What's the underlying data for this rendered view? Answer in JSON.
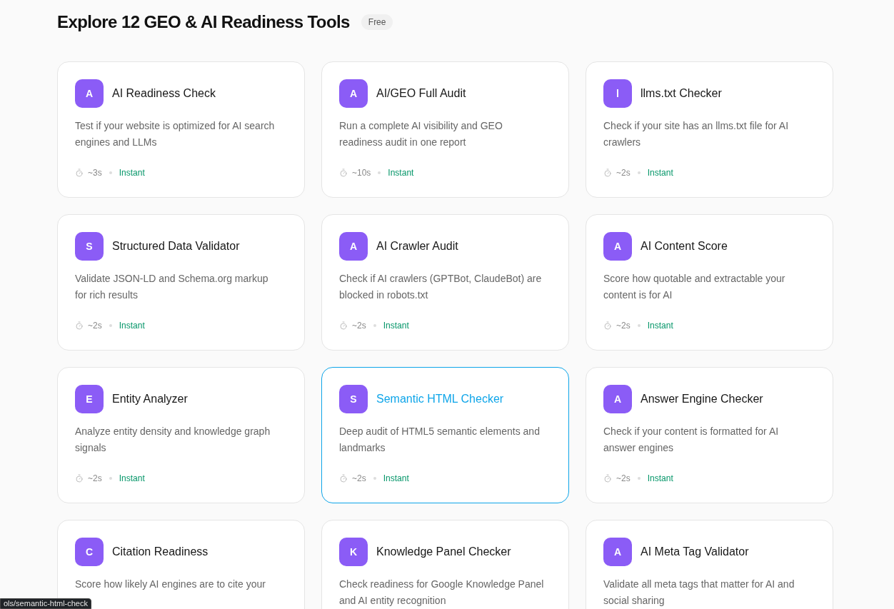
{
  "heading": {
    "title": "Explore 12 GEO & AI Readiness Tools",
    "badge": "Free"
  },
  "tools": [
    {
      "letter": "A",
      "name": "AI Readiness Check",
      "description": "Test if your website is optimized for AI search engines and LLMs",
      "time": "~3s",
      "speed": "Instant",
      "selected": false
    },
    {
      "letter": "A",
      "name": "AI/GEO Full Audit",
      "description": "Run a complete AI visibility and GEO readiness audit in one report",
      "time": "~10s",
      "speed": "Instant",
      "selected": false
    },
    {
      "letter": "l",
      "name": "llms.txt Checker",
      "description": "Check if your site has an llms.txt file for AI crawlers",
      "time": "~2s",
      "speed": "Instant",
      "selected": false
    },
    {
      "letter": "S",
      "name": "Structured Data Validator",
      "description": "Validate JSON-LD and Schema.org markup for rich results",
      "time": "~2s",
      "speed": "Instant",
      "selected": false
    },
    {
      "letter": "A",
      "name": "AI Crawler Audit",
      "description": "Check if AI crawlers (GPTBot, ClaudeBot) are blocked in robots.txt",
      "time": "~2s",
      "speed": "Instant",
      "selected": false
    },
    {
      "letter": "A",
      "name": "AI Content Score",
      "description": "Score how quotable and extractable your content is for AI",
      "time": "~2s",
      "speed": "Instant",
      "selected": false
    },
    {
      "letter": "E",
      "name": "Entity Analyzer",
      "description": "Analyze entity density and knowledge graph signals",
      "time": "~2s",
      "speed": "Instant",
      "selected": false
    },
    {
      "letter": "S",
      "name": "Semantic HTML Checker",
      "description": "Deep audit of HTML5 semantic elements and landmarks",
      "time": "~2s",
      "speed": "Instant",
      "selected": true
    },
    {
      "letter": "A",
      "name": "Answer Engine Checker",
      "description": "Check if your content is formatted for AI answer engines",
      "time": "~2s",
      "speed": "Instant",
      "selected": false
    },
    {
      "letter": "C",
      "name": "Citation Readiness",
      "description": "Score how likely AI engines are to cite your",
      "selected": false
    },
    {
      "letter": "K",
      "name": "Knowledge Panel Checker",
      "description": "Check readiness for Google Knowledge Panel and AI entity recognition",
      "selected": false
    },
    {
      "letter": "A",
      "name": "AI Meta Tag Validator",
      "description": "Validate all meta tags that matter for AI and social sharing",
      "selected": false
    }
  ],
  "status_url": "ols/semantic-html-check"
}
